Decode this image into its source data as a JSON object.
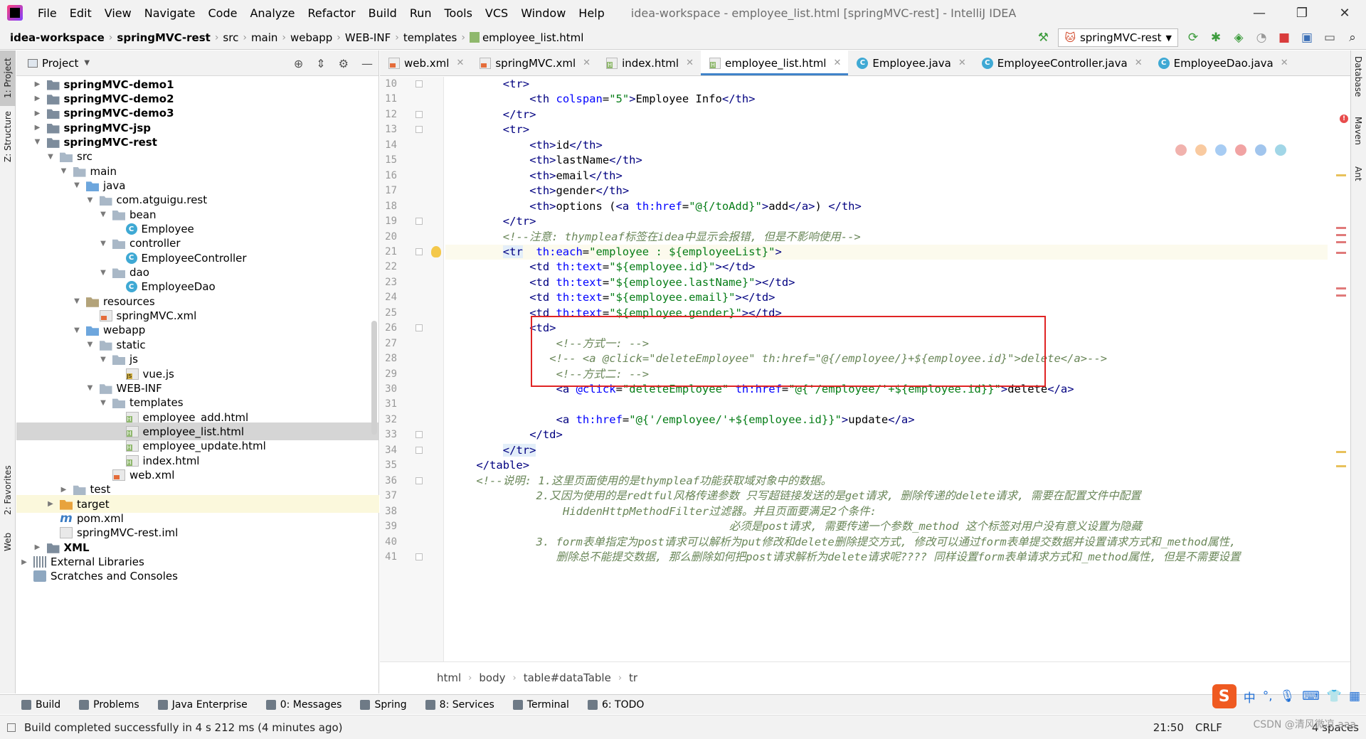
{
  "menubar": {
    "items": [
      "File",
      "Edit",
      "View",
      "Navigate",
      "Code",
      "Analyze",
      "Refactor",
      "Build",
      "Run",
      "Tools",
      "VCS",
      "Window",
      "Help"
    ],
    "window_title": "idea-workspace - employee_list.html [springMVC-rest] - IntelliJ IDEA"
  },
  "navbar": {
    "breadcrumbs": [
      "idea-workspace",
      "springMVC-rest",
      "src",
      "main",
      "webapp",
      "WEB-INF",
      "templates",
      "employee_list.html"
    ],
    "run_config": "springMVC-rest"
  },
  "left_strip": {
    "project": "1: Project",
    "structure": "Z: Structure",
    "favorites": "2: Favorites",
    "web": "Web"
  },
  "right_strip": {
    "database": "Database",
    "maven": "Maven",
    "ant": "Ant"
  },
  "project_panel": {
    "title": "Project"
  },
  "tree": [
    {
      "label": "springMVC-demo1",
      "bold": true,
      "depth": 1,
      "arrow": "▶",
      "icon": "mfolder"
    },
    {
      "label": "springMVC-demo2",
      "bold": true,
      "depth": 1,
      "arrow": "▶",
      "icon": "mfolder"
    },
    {
      "label": "springMVC-demo3",
      "bold": true,
      "depth": 1,
      "arrow": "▶",
      "icon": "mfolder"
    },
    {
      "label": "springMVC-jsp",
      "bold": true,
      "depth": 1,
      "arrow": "▶",
      "icon": "mfolder"
    },
    {
      "label": "springMVC-rest",
      "bold": true,
      "depth": 1,
      "arrow": "▼",
      "icon": "mfolder"
    },
    {
      "label": "src",
      "depth": 2,
      "arrow": "▼",
      "icon": "folder"
    },
    {
      "label": "main",
      "depth": 3,
      "arrow": "▼",
      "icon": "folder"
    },
    {
      "label": "java",
      "depth": 4,
      "arrow": "▼",
      "icon": "srcfolder"
    },
    {
      "label": "com.atguigu.rest",
      "depth": 5,
      "arrow": "▼",
      "icon": "pkg"
    },
    {
      "label": "bean",
      "depth": 6,
      "arrow": "▼",
      "icon": "pkg"
    },
    {
      "label": "Employee",
      "depth": 7,
      "arrow": "",
      "icon": "cls"
    },
    {
      "label": "controller",
      "depth": 6,
      "arrow": "▼",
      "icon": "pkg"
    },
    {
      "label": "EmployeeController",
      "depth": 7,
      "arrow": "",
      "icon": "cls"
    },
    {
      "label": "dao",
      "depth": 6,
      "arrow": "▼",
      "icon": "pkg"
    },
    {
      "label": "EmployeeDao",
      "depth": 7,
      "arrow": "",
      "icon": "cls"
    },
    {
      "label": "resources",
      "depth": 4,
      "arrow": "▼",
      "icon": "resfolder"
    },
    {
      "label": "springMVC.xml",
      "depth": 5,
      "arrow": "",
      "icon": "xml"
    },
    {
      "label": "webapp",
      "depth": 4,
      "arrow": "▼",
      "icon": "srcfolder"
    },
    {
      "label": "static",
      "depth": 5,
      "arrow": "▼",
      "icon": "folder"
    },
    {
      "label": "js",
      "depth": 6,
      "arrow": "▼",
      "icon": "folder"
    },
    {
      "label": "vue.js",
      "depth": 7,
      "arrow": "",
      "icon": "js"
    },
    {
      "label": "WEB-INF",
      "depth": 5,
      "arrow": "▼",
      "icon": "folder"
    },
    {
      "label": "templates",
      "depth": 6,
      "arrow": "▼",
      "icon": "folder"
    },
    {
      "label": "employee_add.html",
      "depth": 7,
      "arrow": "",
      "icon": "html"
    },
    {
      "label": "employee_list.html",
      "depth": 7,
      "arrow": "",
      "icon": "html",
      "selected": true
    },
    {
      "label": "employee_update.html",
      "depth": 7,
      "arrow": "",
      "icon": "html"
    },
    {
      "label": "index.html",
      "depth": 7,
      "arrow": "",
      "icon": "html"
    },
    {
      "label": "web.xml",
      "depth": 6,
      "arrow": "",
      "icon": "xml"
    },
    {
      "label": "test",
      "depth": 3,
      "arrow": "▶",
      "icon": "folder"
    },
    {
      "label": "target",
      "depth": 2,
      "arrow": "▶",
      "icon": "orange",
      "target": true
    },
    {
      "label": "pom.xml",
      "depth": 2,
      "arrow": "",
      "icon": "m"
    },
    {
      "label": "springMVC-rest.iml",
      "depth": 2,
      "arrow": "",
      "icon": "iml"
    },
    {
      "label": "XML",
      "bold": true,
      "depth": 1,
      "arrow": "▶",
      "icon": "mfolder"
    },
    {
      "label": "External Libraries",
      "depth": 0,
      "arrow": "▶",
      "icon": "lib"
    },
    {
      "label": "Scratches and Consoles",
      "depth": 0,
      "arrow": "",
      "icon": "scratch"
    }
  ],
  "tabs": [
    {
      "label": "web.xml",
      "icon": "xml"
    },
    {
      "label": "springMVC.xml",
      "icon": "xml"
    },
    {
      "label": "index.html",
      "icon": "html"
    },
    {
      "label": "employee_list.html",
      "icon": "html",
      "active": true
    },
    {
      "label": "Employee.java",
      "icon": "cls"
    },
    {
      "label": "EmployeeController.java",
      "icon": "cls"
    },
    {
      "label": "EmployeeDao.java",
      "icon": "cls"
    }
  ],
  "code_lines": [
    {
      "n": "10",
      "indent": 8,
      "segs": [
        [
          "t-tag",
          "<tr>"
        ]
      ]
    },
    {
      "n": "11",
      "indent": 12,
      "segs": [
        [
          "t-tag",
          "<th "
        ],
        [
          "t-attr",
          "colspan"
        ],
        [
          "",
          "="
        ],
        [
          "t-str",
          "\"5\""
        ],
        [
          "t-tag",
          ">"
        ],
        [
          "",
          "Employee Info"
        ],
        [
          "t-tag",
          "</th>"
        ]
      ]
    },
    {
      "n": "12",
      "indent": 8,
      "segs": [
        [
          "t-tag",
          "</tr>"
        ]
      ]
    },
    {
      "n": "13",
      "indent": 8,
      "segs": [
        [
          "t-tag",
          "<tr>"
        ]
      ]
    },
    {
      "n": "14",
      "indent": 12,
      "segs": [
        [
          "t-tag",
          "<th>"
        ],
        [
          "",
          "id"
        ],
        [
          "t-tag",
          "</th>"
        ]
      ]
    },
    {
      "n": "15",
      "indent": 12,
      "segs": [
        [
          "t-tag",
          "<th>"
        ],
        [
          "",
          "lastName"
        ],
        [
          "t-tag",
          "</th>"
        ]
      ]
    },
    {
      "n": "16",
      "indent": 12,
      "segs": [
        [
          "t-tag",
          "<th>"
        ],
        [
          "",
          "email"
        ],
        [
          "t-tag",
          "</th>"
        ]
      ]
    },
    {
      "n": "17",
      "indent": 12,
      "segs": [
        [
          "t-tag",
          "<th>"
        ],
        [
          "",
          "gender"
        ],
        [
          "t-tag",
          "</th>"
        ]
      ]
    },
    {
      "n": "18",
      "indent": 12,
      "segs": [
        [
          "t-tag",
          "<th>"
        ],
        [
          "",
          "options ("
        ],
        [
          "t-tag",
          "<a "
        ],
        [
          "t-attr",
          "th:href"
        ],
        [
          "",
          "="
        ],
        [
          "t-str",
          "\"@{/toAdd}\""
        ],
        [
          "t-tag",
          ">"
        ],
        [
          "",
          "add"
        ],
        [
          "t-tag",
          "</a>"
        ],
        [
          "",
          ") "
        ],
        [
          "t-tag",
          "</th>"
        ]
      ]
    },
    {
      "n": "19",
      "indent": 8,
      "segs": [
        [
          "t-tag",
          "</tr>"
        ]
      ]
    },
    {
      "n": "20",
      "indent": 8,
      "segs": [
        [
          "t-cmt-g",
          "<!--注意: thympleaf标签在idea中显示会报错, 但是不影响使用-->"
        ]
      ]
    },
    {
      "n": "21",
      "indent": 8,
      "current": true,
      "segs": [
        [
          "t-tag hl-tr",
          "<tr"
        ],
        [
          "",
          "  "
        ],
        [
          "t-attr",
          "th:each"
        ],
        [
          "",
          "="
        ],
        [
          "t-str",
          "\"employee : ${employeeList}\""
        ],
        [
          "t-tag",
          ">"
        ]
      ]
    },
    {
      "n": "22",
      "indent": 12,
      "segs": [
        [
          "t-tag",
          "<td "
        ],
        [
          "t-attr",
          "th:text"
        ],
        [
          "",
          "="
        ],
        [
          "t-str",
          "\"${employee.id}\""
        ],
        [
          "t-tag",
          "></td>"
        ]
      ]
    },
    {
      "n": "23",
      "indent": 12,
      "segs": [
        [
          "t-tag",
          "<td "
        ],
        [
          "t-attr",
          "th:text"
        ],
        [
          "",
          "="
        ],
        [
          "t-str",
          "\"${employee.lastName}\""
        ],
        [
          "t-tag",
          "></td>"
        ]
      ]
    },
    {
      "n": "24",
      "indent": 12,
      "segs": [
        [
          "t-tag",
          "<td "
        ],
        [
          "t-attr",
          "th:text"
        ],
        [
          "",
          "="
        ],
        [
          "t-str",
          "\"${employee.email}\""
        ],
        [
          "t-tag",
          "></td>"
        ]
      ]
    },
    {
      "n": "25",
      "indent": 12,
      "segs": [
        [
          "t-tag",
          "<td "
        ],
        [
          "t-attr",
          "th:text"
        ],
        [
          "",
          "="
        ],
        [
          "t-str",
          "\"${employee.gender}\""
        ],
        [
          "t-tag",
          "></td>"
        ]
      ]
    },
    {
      "n": "26",
      "indent": 12,
      "segs": [
        [
          "t-tag",
          "<td>"
        ]
      ]
    },
    {
      "n": "27",
      "indent": 16,
      "segs": [
        [
          "t-cmt-g",
          "<!--方式一: -->"
        ]
      ]
    },
    {
      "n": "28",
      "indent": 15,
      "segs": [
        [
          "t-cmt-g",
          "<!-- <a @click=\"deleteEmployee\" th:href=\"@{/employee/}+${employee.id}\">delete</a>-->"
        ]
      ]
    },
    {
      "n": "29",
      "indent": 16,
      "segs": [
        [
          "t-cmt-g",
          "<!--方式二: -->"
        ]
      ]
    },
    {
      "n": "30",
      "indent": 16,
      "segs": [
        [
          "t-tag",
          "<a "
        ],
        [
          "t-attr",
          "@click"
        ],
        [
          "",
          "="
        ],
        [
          "t-str",
          "\"deleteEmployee\" "
        ],
        [
          "t-attr",
          "th:href"
        ],
        [
          "",
          "="
        ],
        [
          "t-str",
          "\"@{'/employee/'+${employee.id}}\""
        ],
        [
          "t-tag",
          ">"
        ],
        [
          "",
          "delete"
        ],
        [
          "t-tag",
          "</a>"
        ]
      ]
    },
    {
      "n": "31",
      "indent": 0,
      "segs": []
    },
    {
      "n": "32",
      "indent": 16,
      "segs": [
        [
          "t-tag",
          "<a "
        ],
        [
          "t-attr",
          "th:href"
        ],
        [
          "",
          "="
        ],
        [
          "t-str",
          "\"@{'/employee/'+${employee.id}}\""
        ],
        [
          "t-tag",
          ">"
        ],
        [
          "",
          "update"
        ],
        [
          "t-tag",
          "</a>"
        ]
      ]
    },
    {
      "n": "33",
      "indent": 12,
      "segs": [
        [
          "t-tag",
          "</td>"
        ]
      ]
    },
    {
      "n": "34",
      "indent": 8,
      "segs": [
        [
          "t-tag hl-tr",
          "</tr>"
        ]
      ]
    },
    {
      "n": "35",
      "indent": 4,
      "segs": [
        [
          "t-tag",
          "</table>"
        ]
      ]
    },
    {
      "n": "36",
      "indent": 4,
      "segs": [
        [
          "t-cmt-g",
          "<!--说明: 1.这里页面使用的是thympleaf功能获取域对象中的数据。"
        ]
      ]
    },
    {
      "n": "37",
      "indent": 13,
      "segs": [
        [
          "t-cmt-g",
          "2.又因为使用的是redtful风格传递参数 只写超链接发送的是get请求, 删除传递的delete请求, 需要在配置文件中配置"
        ]
      ]
    },
    {
      "n": "38",
      "indent": 17,
      "segs": [
        [
          "t-cmt-g",
          "HiddenHttpMethodFilter过滤器。并且页面要满足2个条件:"
        ]
      ]
    },
    {
      "n": "39",
      "indent": 42,
      "segs": [
        [
          "t-cmt-g",
          "必须是post请求, 需要传递一个参数_method 这个标签对用户没有意义设置为隐藏"
        ]
      ]
    },
    {
      "n": "40",
      "indent": 13,
      "segs": [
        [
          "t-cmt-g",
          "3. form表单指定为post请求可以解析为put修改和delete删除提交方式, 修改可以通过form表单提交数据并设置请求方式和_method属性,"
        ]
      ]
    },
    {
      "n": "41",
      "indent": 16,
      "segs": [
        [
          "t-cmt-g",
          "删除总不能提交数据, 那么删除如何把post请求解析为delete请求呢???? 同样设置form表单请求方式和_method属性, 但是不需要设置"
        ]
      ]
    }
  ],
  "editor_breadcrumb": [
    "html",
    "body",
    "table#dataTable",
    "tr"
  ],
  "bottom_tools": [
    {
      "label": "Build"
    },
    {
      "label": "Problems"
    },
    {
      "label": "Java Enterprise"
    },
    {
      "label": "0: Messages"
    },
    {
      "label": "Spring"
    },
    {
      "label": "8: Services"
    },
    {
      "label": "Terminal"
    },
    {
      "label": "6: TODO"
    }
  ],
  "status": {
    "message": "Build completed successfully in 4 s 212 ms (4 minutes ago)",
    "position": "21:50",
    "line_sep": "CRLF",
    "indent": "4 spaces"
  },
  "ime": {
    "lang": "中"
  },
  "watermark": "CSDN @清风微凉 aaa"
}
